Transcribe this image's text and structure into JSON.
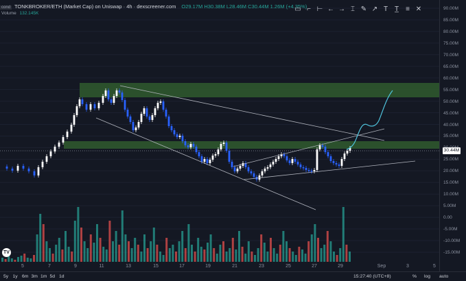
{
  "header": {
    "badge": "cond",
    "title": "TONKBROKER/ETH (Market Cap) on Uniswap · 4h · dexscreener.com",
    "ohlc": "O29.17M H30.38M L28.46M C30.44M 1.26M (+4.35%)",
    "volume_label": "Volume",
    "volume_value": "132.145K"
  },
  "toolbar": {
    "icons": [
      "rectangle-icon",
      "path-icon",
      "horizontal-arrow-icon",
      "left-arrow-icon",
      "right-arrow-icon",
      "vertical-line-icon",
      "brush-icon",
      "arrow-up-right-icon",
      "text-icon",
      "text-box-icon",
      "settings-list-icon",
      "close-icon"
    ],
    "glyphs": [
      "▭",
      "⌐",
      "⊢",
      "←",
      "→",
      "⌶",
      "✎",
      "↗",
      "T",
      "T̲",
      "≡",
      "✕"
    ]
  },
  "price_axis": {
    "labels": [
      "90.00M",
      "85.00M",
      "80.00M",
      "75.00M",
      "70.00M",
      "65.00M",
      "60.00M",
      "55.00M",
      "50.00M",
      "45.00M",
      "40.00M",
      "35.00M",
      "30.00M",
      "25.00M",
      "20.00M",
      "15.00M",
      "10.00M",
      "5.00M",
      "0.00",
      "-5.00M",
      "-10.00M",
      "-15.00M"
    ],
    "current_price": "30.44M"
  },
  "time_axis": {
    "labels": [
      "5",
      "7",
      "9",
      "11",
      "13",
      "15",
      "17",
      "19",
      "21",
      "23",
      "25",
      "27",
      "29",
      "Sep",
      "3",
      "5"
    ]
  },
  "bottom_bar": {
    "timeframes": [
      "5y",
      "1y",
      "6m",
      "3m",
      "1m",
      "5d",
      "1d"
    ],
    "clock": "15:27:40 (UTC+8)",
    "right_items": [
      "%",
      "log",
      "auto"
    ]
  },
  "logo_text": "TV",
  "colors": {
    "background": "#141823",
    "up_candle": "#ffffff",
    "down_candle": "#2962ff",
    "volume_up": "#26a69a",
    "volume_down": "#ef5350",
    "zone": "#2f5a2e",
    "trendline": "#b2b5be",
    "projection": "#4fc3dc"
  }
}
